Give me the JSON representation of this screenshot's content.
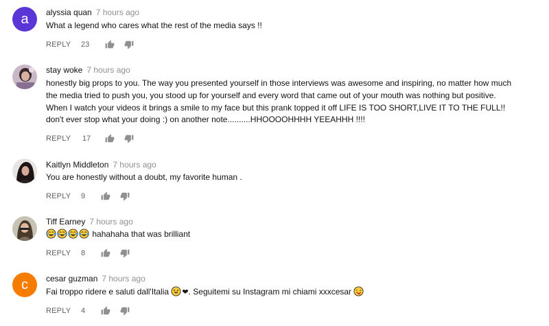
{
  "comments": [
    {
      "author": "alyssia quan",
      "time": "7 hours ago",
      "avatar_letter": "a",
      "avatar_color": "#5b36d6",
      "text": "What a legend who cares what the rest of the media says !!",
      "reply_label": "REPLY",
      "likes": "23"
    },
    {
      "author": "stay woke",
      "time": "7 hours ago",
      "text": "honestly big props to you. The way you presented yourself in those interviews was awesome and inspiring, no matter how much the media tried to push you, you stood up for yourself and every word that came out of your mouth was nothing but positive. When I watch your videos it brings a smile to my face but this prank topped it off LIFE IS TOO SHORT,LIVE IT TO THE FULL!! don't ever stop what your doing :) on another note..........HHOOOOHHHH YEEAHHH !!!!",
      "reply_label": "REPLY",
      "likes": "17"
    },
    {
      "author": "Kaitlyn Middleton",
      "time": "7 hours ago",
      "text": "You are honestly without a doubt, my favorite human .",
      "reply_label": "REPLY",
      "likes": "9"
    },
    {
      "author": "Tiff Earney",
      "time": "7 hours ago",
      "text": "hahahaha that was brilliant",
      "reply_label": "REPLY",
      "likes": "8"
    },
    {
      "author": "cesar guzman",
      "time": "7 hours ago",
      "avatar_letter": "c",
      "avatar_color": "#f57c00",
      "text_before": "Fai troppo ridere e saluti dall'Italia",
      "text_after": ". Seguitemi su Instagram mi chiami xxxcesar",
      "reply_label": "REPLY",
      "likes": "4"
    }
  ],
  "icons": {
    "like": "thumb-up-icon",
    "dislike": "thumb-down-icon"
  }
}
